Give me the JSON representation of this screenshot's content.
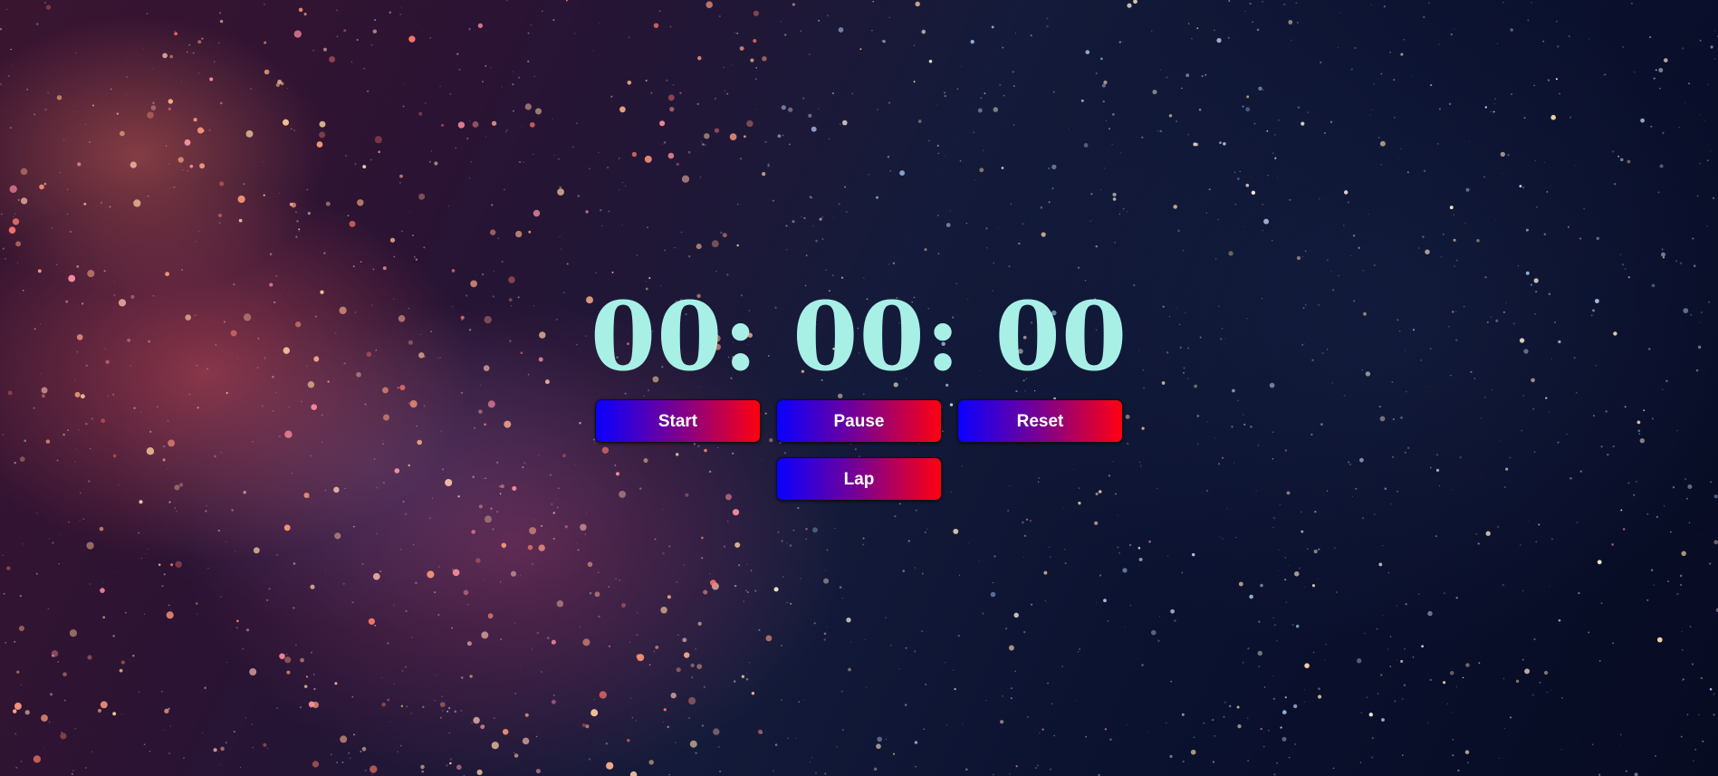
{
  "stopwatch": {
    "time": "00: 00: 00",
    "buttons": {
      "start": "Start",
      "pause": "Pause",
      "reset": "Reset",
      "lap": "Lap"
    }
  },
  "colors": {
    "time_text": "#a8f0e6",
    "button_gradient_start": "#0a00ff",
    "button_gradient_end": "#ff0010",
    "button_text": "#ffffff"
  }
}
